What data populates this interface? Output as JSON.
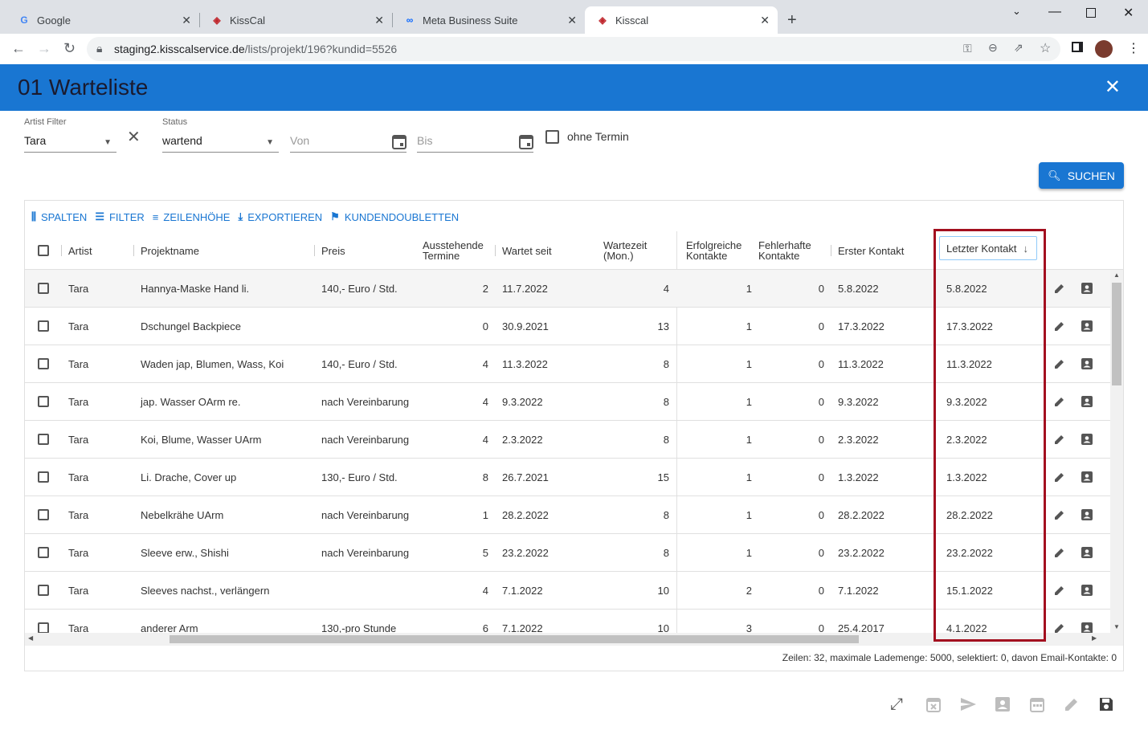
{
  "browser": {
    "tabs": [
      {
        "title": "Google",
        "icon": "google-icon"
      },
      {
        "title": "KissCal",
        "icon": "kisscal-icon"
      },
      {
        "title": "Meta Business Suite",
        "icon": "meta-icon"
      },
      {
        "title": "Kisscal",
        "icon": "kisscal-icon",
        "active": true
      }
    ],
    "url_host": "staging2.kisscalservice.de",
    "url_path": "/lists/projekt/196?kundid=5526"
  },
  "app": {
    "title": "01 Warteliste",
    "accent": "#1976d2"
  },
  "filters": {
    "artist_label": "Artist Filter",
    "artist_value": "Tara",
    "status_label": "Status",
    "status_value": "wartend",
    "von_placeholder": "Von",
    "bis_placeholder": "Bis",
    "ohne_termin": "ohne Termin",
    "search_button": "SUCHEN"
  },
  "toolbar": {
    "spalten": "SPALTEN",
    "filter": "FILTER",
    "zeilenhoehe": "ZEILENHÖHE",
    "exportieren": "EXPORTIEREN",
    "kundendoubletten": "KUNDENDOUBLETTEN"
  },
  "columns": {
    "artist": "Artist",
    "projektname": "Projektname",
    "preis": "Preis",
    "ausstehende1": "Ausstehende",
    "ausstehende2": "Termine",
    "wartet_seit": "Wartet seit",
    "wartezeit1": "Wartezeit",
    "wartezeit2": "(Mon.)",
    "erfolgreiche1": "Erfolgreiche",
    "erfolgreiche2": "Kontakte",
    "fehlerhafte1": "Fehlerhafte",
    "fehlerhafte2": "Kontakte",
    "erster_kontakt": "Erster Kontakt",
    "letzter_kontakt": "Letzter Kontakt",
    "sort_icon": "arrow-down-icon"
  },
  "rows": [
    {
      "artist": "Tara",
      "projekt": "Hannya-Maske Hand li.",
      "preis": "140,- Euro / Std.",
      "termine": "2",
      "seit": "11.7.2022",
      "wartezeit": "4",
      "erfolg": "1",
      "fehler": "0",
      "erster": "5.8.2022",
      "letzter": "5.8.2022"
    },
    {
      "artist": "Tara",
      "projekt": "Dschungel Backpiece",
      "preis": "",
      "termine": "0",
      "seit": "30.9.2021",
      "wartezeit": "13",
      "erfolg": "1",
      "fehler": "0",
      "erster": "17.3.2022",
      "letzter": "17.3.2022"
    },
    {
      "artist": "Tara",
      "projekt": "Waden jap, Blumen, Wass, Koi",
      "preis": "140,- Euro / Std.",
      "termine": "4",
      "seit": "11.3.2022",
      "wartezeit": "8",
      "erfolg": "1",
      "fehler": "0",
      "erster": "11.3.2022",
      "letzter": "11.3.2022"
    },
    {
      "artist": "Tara",
      "projekt": "jap. Wasser OArm re.",
      "preis": "nach Vereinbarung",
      "termine": "4",
      "seit": "9.3.2022",
      "wartezeit": "8",
      "erfolg": "1",
      "fehler": "0",
      "erster": "9.3.2022",
      "letzter": "9.3.2022"
    },
    {
      "artist": "Tara",
      "projekt": "Koi, Blume, Wasser UArm",
      "preis": "nach Vereinbarung",
      "termine": "4",
      "seit": "2.3.2022",
      "wartezeit": "8",
      "erfolg": "1",
      "fehler": "0",
      "erster": "2.3.2022",
      "letzter": "2.3.2022"
    },
    {
      "artist": "Tara",
      "projekt": "Li. Drache, Cover up",
      "preis": "130,- Euro / Std.",
      "termine": "8",
      "seit": "26.7.2021",
      "wartezeit": "15",
      "erfolg": "1",
      "fehler": "0",
      "erster": "1.3.2022",
      "letzter": "1.3.2022"
    },
    {
      "artist": "Tara",
      "projekt": "Nebelkrähe UArm",
      "preis": "nach Vereinbarung",
      "termine": "1",
      "seit": "28.2.2022",
      "wartezeit": "8",
      "erfolg": "1",
      "fehler": "0",
      "erster": "28.2.2022",
      "letzter": "28.2.2022"
    },
    {
      "artist": "Tara",
      "projekt": "Sleeve erw., Shishi",
      "preis": "nach Vereinbarung",
      "termine": "5",
      "seit": "23.2.2022",
      "wartezeit": "8",
      "erfolg": "1",
      "fehler": "0",
      "erster": "23.2.2022",
      "letzter": "23.2.2022"
    },
    {
      "artist": "Tara",
      "projekt": "Sleeves nachst., verlängern",
      "preis": "",
      "termine": "4",
      "seit": "7.1.2022",
      "wartezeit": "10",
      "erfolg": "2",
      "fehler": "0",
      "erster": "7.1.2022",
      "letzter": "15.1.2022"
    },
    {
      "artist": "Tara",
      "projekt": "anderer Arm",
      "preis": "130,-pro Stunde",
      "termine": "6",
      "seit": "7.1.2022",
      "wartezeit": "10",
      "erfolg": "3",
      "fehler": "0",
      "erster": "25.4.2017",
      "letzter": "4.1.2022"
    }
  ],
  "row_actions": [
    "edit-icon",
    "contact-card-icon"
  ],
  "status": "Zeilen: 32, maximale Lademenge: 5000, selektiert: 0, davon Email-Kontakte: 0",
  "bottom_icons": [
    "fullscreen-icon",
    "calendar-x-icon",
    "send-icon",
    "contact-icon",
    "calendar-icon",
    "pencil-icon",
    "save-icon"
  ],
  "highlight_color": "#a30f1f"
}
